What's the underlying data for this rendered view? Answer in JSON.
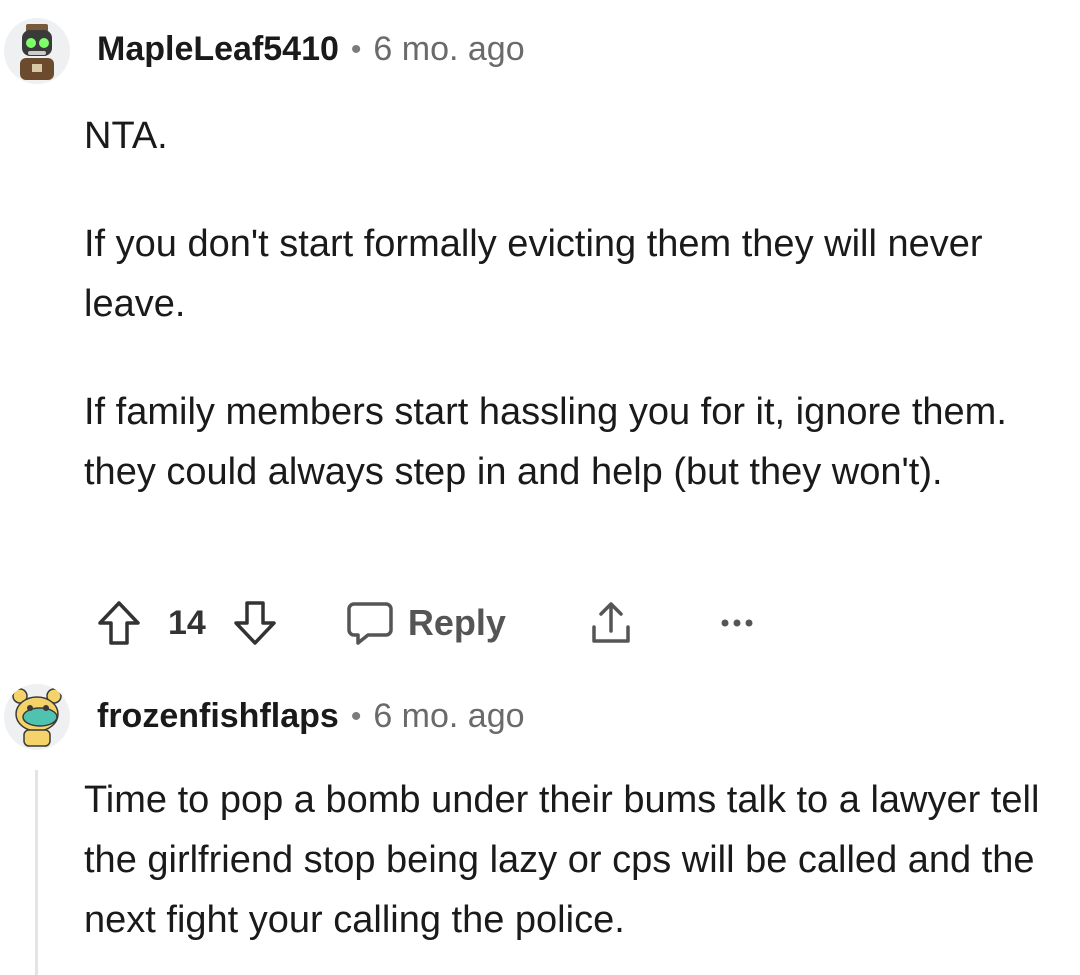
{
  "comments": [
    {
      "username": "MapleLeaf5410",
      "separator": "•",
      "timestamp": "6 mo. ago",
      "paragraphs": [
        "NTA.",
        "If you don't start formally evicting them they will never leave.",
        "If family members start hassling you for it, ignore them. they could always step in and help (but they won't)."
      ],
      "votes": "14",
      "reply_label": "Reply",
      "avatar_icon": "robot-avatar-icon"
    },
    {
      "username": "frozenfishflaps",
      "separator": "•",
      "timestamp": "6 mo. ago",
      "paragraphs": [
        "Time to pop a bomb under their bums talk to a lawyer tell the girlfriend stop being lazy or cps will be called and the next fight your calling the police."
      ],
      "avatar_icon": "creature-avatar-icon"
    }
  ],
  "colors": {
    "text": "#1a1a1b",
    "meta": "#6a6a6a",
    "icon": "#555555",
    "thread_line": "#e2e4e6"
  }
}
